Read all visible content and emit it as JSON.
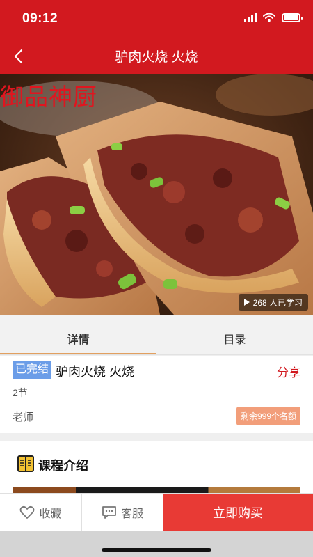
{
  "status_bar": {
    "time": "09:12"
  },
  "nav": {
    "title": "驴肉火烧 火烧"
  },
  "hero": {
    "watermark": "御品神厨",
    "learners": "268 人已学习"
  },
  "tabs": [
    {
      "label": "详情",
      "active": true
    },
    {
      "label": "目录",
      "active": false
    }
  ],
  "course": {
    "status_badge": "已完结",
    "title": "驴肉火烧 火烧",
    "share_label": "分享",
    "lessons": "2节",
    "teacher": "老师",
    "quota": "剩余999个名额"
  },
  "intro": {
    "title": "课程介绍"
  },
  "bottom_bar": {
    "favorite_label": "收藏",
    "service_label": "客服",
    "buy_label": "立即购买"
  },
  "colors": {
    "brand_red": "#d2191f",
    "buy_red": "#e83a35",
    "badge_blue": "#6b9de8",
    "quota_orange": "#f29e7a"
  }
}
